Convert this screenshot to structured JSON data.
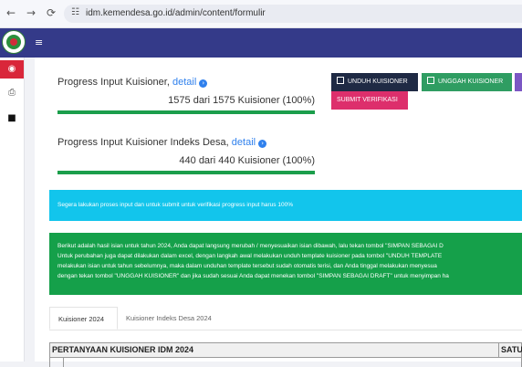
{
  "browser": {
    "url": "idm.kemendesa.go.id/admin/content/formulir",
    "back_icon": "←",
    "forward_icon": "→",
    "reload_icon": "⟳",
    "site_info_icon": "☷"
  },
  "header": {
    "menu_icon": "≡"
  },
  "sidebar": {
    "items": [
      {
        "name": "dashboard-icon",
        "glyph": "◉"
      },
      {
        "name": "document-icon",
        "glyph": "⎙"
      },
      {
        "name": "folder-icon",
        "glyph": "■"
      }
    ]
  },
  "progress": [
    {
      "title": "Progress Input Kuisioner,",
      "link": "detail",
      "count": "1575 dari 1575 Kuisioner (100%)",
      "percent": 100
    },
    {
      "title": "Progress Input Kuisioner Indeks Desa,",
      "link": "detail",
      "count": "440 dari 440 Kuisioner (100%)",
      "percent": 100
    }
  ],
  "actions": {
    "unduh": "UNDUH KUISIONER",
    "unggah": "UNGGAH KUISIONER",
    "submit": "SUBMIT VERIFIKASI"
  },
  "alerts": {
    "info": "Segera lakukan proses input dan untuk submit untuk verifikasi progress input harus 100%",
    "success_lines": [
      "Berikut adalah hasil isian untuk tahun 2024, Anda dapat langsung merubah / menyesuaikan isian dibawah, lalu tekan tombol \"SIMPAN SEBAGAI D",
      "Untuk perubahan juga dapat dilakukan dalam excel, dengan langkah awal melakukan unduh template kuisioner pada tombol \"UNDUH TEMPLATE",
      "melakukan isian untuk tahun sebelumnya, maka dalam unduhan template tersebut sudah otomatis terisi, dan Anda tinggal melakukan menyesua",
      "dengan tekan tombol \"UNGGAH KUISIONER\" dan jika sudah sesuai Anda dapat menekan tombol \"SIMPAN SEBAGAI DRAFT\" untuk menyimpan ha"
    ]
  },
  "tabs": [
    {
      "label": "Kuisioner 2024",
      "active": true
    },
    {
      "label": "Kuisioner Indeks Desa 2024",
      "active": false
    }
  ],
  "table": {
    "header_main": "PERTANYAAN KUISIONER IDM 2024",
    "header_unit": "SATU"
  },
  "colors": {
    "header_bg": "#343a89",
    "sidebar_active": "#d9263a",
    "progress_fill": "#1b9e4b",
    "info_alert": "#12c5ec",
    "success_alert": "#15a04a",
    "btn_submit": "#dd2f6c"
  }
}
